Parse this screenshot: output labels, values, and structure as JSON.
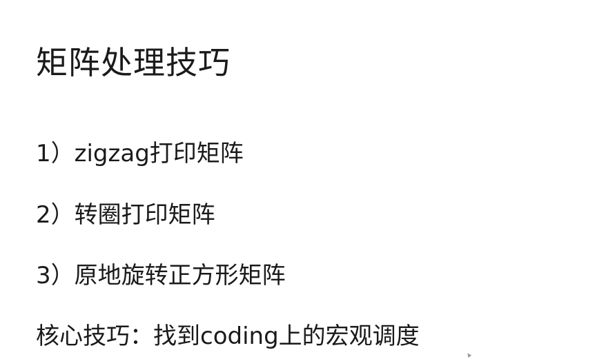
{
  "slide": {
    "title": "矩阵处理技巧",
    "items": [
      {
        "num": "1）",
        "text": "zigzag打印矩阵"
      },
      {
        "num": "2）",
        "text": "转圈打印矩阵"
      },
      {
        "num": "3）",
        "text": "原地旋转正方形矩阵"
      }
    ],
    "core_tip": "核心技巧：找到coding上的宏观调度"
  }
}
